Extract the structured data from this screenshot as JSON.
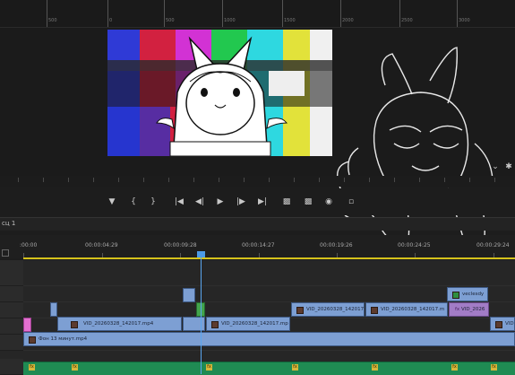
{
  "ruler": {
    "labels": [
      "0",
      "500",
      "0",
      "500",
      "1000",
      "1500",
      "2000",
      "2500",
      "3000"
    ]
  },
  "sequence": {
    "tab_label": "сц 1"
  },
  "timecodes": [
    ":00:00",
    "00:00:04:29",
    "00:00:09:28",
    "00:00:14:27",
    "00:00:19:26",
    "00:00:24:25",
    "00:00:29:24"
  ],
  "clips": {
    "v3_veclesdy": "veclesdy",
    "v2_vid_a": "VID_20260328_142017",
    "v2_vid_b": "VID_20260328_142017.m",
    "v2_vid_c_fx": "fx",
    "v2_vid_c": "VID_2026",
    "v1_vid_a": "VID_20260328_142017.mp4",
    "v1_vid_b": "VID_20260328_142017.mp",
    "v1_vid_c": "VID",
    "bg_clip": "Фон 13 минут.mp4"
  },
  "audio_fx_label": "fx",
  "colors": {
    "clip_blue": "#7d9fd3",
    "clip_green": "#43a44d",
    "clip_violet": "#a27cc6",
    "audio_green": "#1f8b53",
    "playhead": "#5aa6f0",
    "work_area": "#d5c21b"
  }
}
